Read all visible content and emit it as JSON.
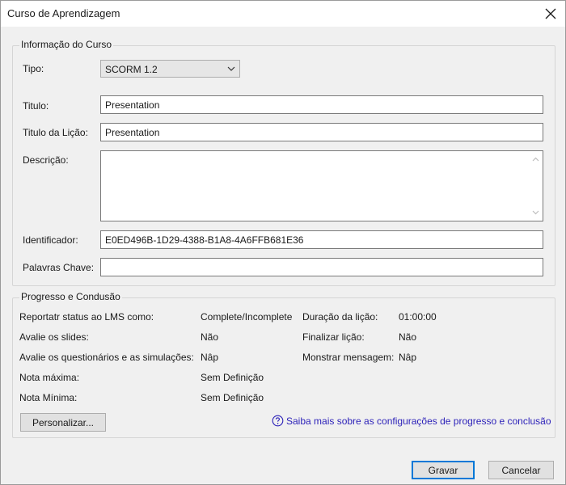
{
  "window": {
    "title": "Curso de Aprendizagem"
  },
  "course_info": {
    "legend": "Informação do Curso",
    "type_label": "Tipo:",
    "type_value": "SCORM 1.2",
    "title_label": "Titulo:",
    "title_value": "Presentation",
    "lesson_title_label": "Titulo da Lição:",
    "lesson_title_value": "Presentation",
    "description_label": "Descrição:",
    "description_value": "",
    "identifier_label": "Identificador:",
    "identifier_value": "E0ED496B-1D29-4388-B1A8-4A6FFB681E36",
    "keywords_label": "Palavras Chave:",
    "keywords_value": ""
  },
  "progress": {
    "legend": "Progresso e Condusão",
    "rows": [
      {
        "label": "Reportatr status ao LMS como:",
        "value": "Complete/Incomplete"
      },
      {
        "label": "Avalie os slides:",
        "value": "Não"
      },
      {
        "label": "Avalie os questionários e as simulações:",
        "value": "Nâp"
      },
      {
        "label": "Nota máxima:",
        "value": "Sem Definição"
      },
      {
        "label": "Nota Mínima:",
        "value": "Sem Definição"
      }
    ],
    "right_rows": [
      {
        "label": "Duração da lição:",
        "value": "01:00:00"
      },
      {
        "label": "Finalizar lição:",
        "value": "Não"
      },
      {
        "label": "Monstrar mensagem:",
        "value": "Nâp"
      }
    ],
    "customize_button": "Personalizar...",
    "help_link": "Saiba mais sobre as configurações de progresso e conclusão"
  },
  "footer": {
    "save_button": "Gravar",
    "cancel_button": "Cancelar"
  },
  "colors": {
    "accent": "#0078d7",
    "link": "#2a1fb8",
    "dialog_bg": "#f0f0f0"
  },
  "icons": {
    "close": "close-icon",
    "dropdown": "chevron-down-icon",
    "help": "help-circle-icon"
  }
}
